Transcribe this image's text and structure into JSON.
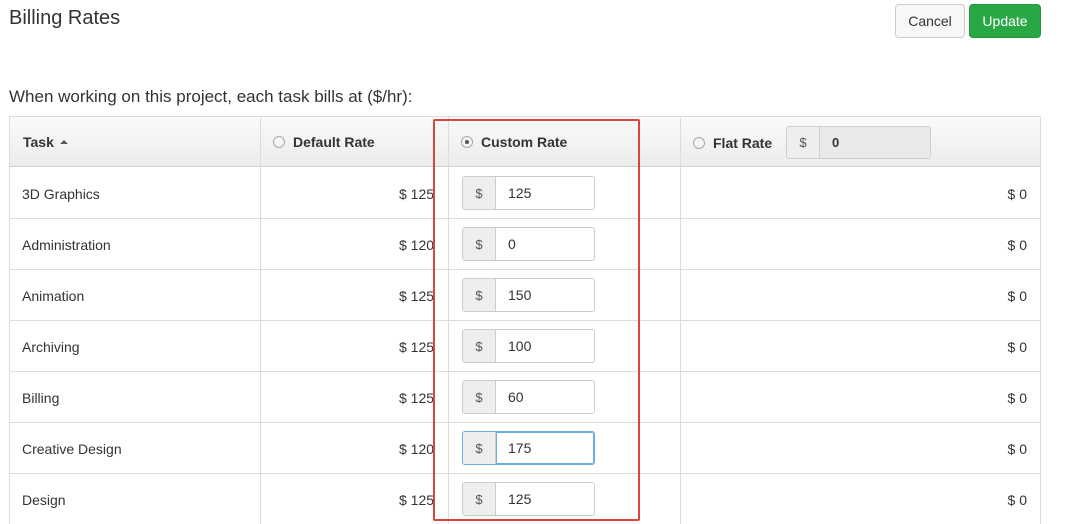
{
  "header": {
    "title": "Billing Rates",
    "cancel_label": "Cancel",
    "update_label": "Update"
  },
  "intro_text": "When working on this project, each task bills at ($/hr):",
  "columns": {
    "task": "Task",
    "default_rate": "Default Rate",
    "custom_rate": "Custom Rate",
    "flat_rate": "Flat Rate",
    "flat_rate_prefix": "$",
    "flat_rate_value": "0",
    "selected": "custom_rate"
  },
  "rows": [
    {
      "task": "3D Graphics",
      "default": "$ 125",
      "custom_prefix": "$",
      "custom": "125",
      "flat": "$ 0"
    },
    {
      "task": "Administration",
      "default": "$ 120",
      "custom_prefix": "$",
      "custom": "0",
      "flat": "$ 0"
    },
    {
      "task": "Animation",
      "default": "$ 125",
      "custom_prefix": "$",
      "custom": "150",
      "flat": "$ 0"
    },
    {
      "task": "Archiving",
      "default": "$ 125",
      "custom_prefix": "$",
      "custom": "100",
      "flat": "$ 0"
    },
    {
      "task": "Billing",
      "default": "$ 125",
      "custom_prefix": "$",
      "custom": "60",
      "flat": "$ 0"
    },
    {
      "task": "Creative Design",
      "default": "$ 120",
      "custom_prefix": "$",
      "custom": "175",
      "flat": "$ 0"
    },
    {
      "task": "Design",
      "default": "$ 125",
      "custom_prefix": "$",
      "custom": "125",
      "flat": "$ 0"
    }
  ],
  "colors": {
    "update_button": "#28a745",
    "highlight_border": "#d9463b",
    "focus_border": "#66afe9"
  }
}
